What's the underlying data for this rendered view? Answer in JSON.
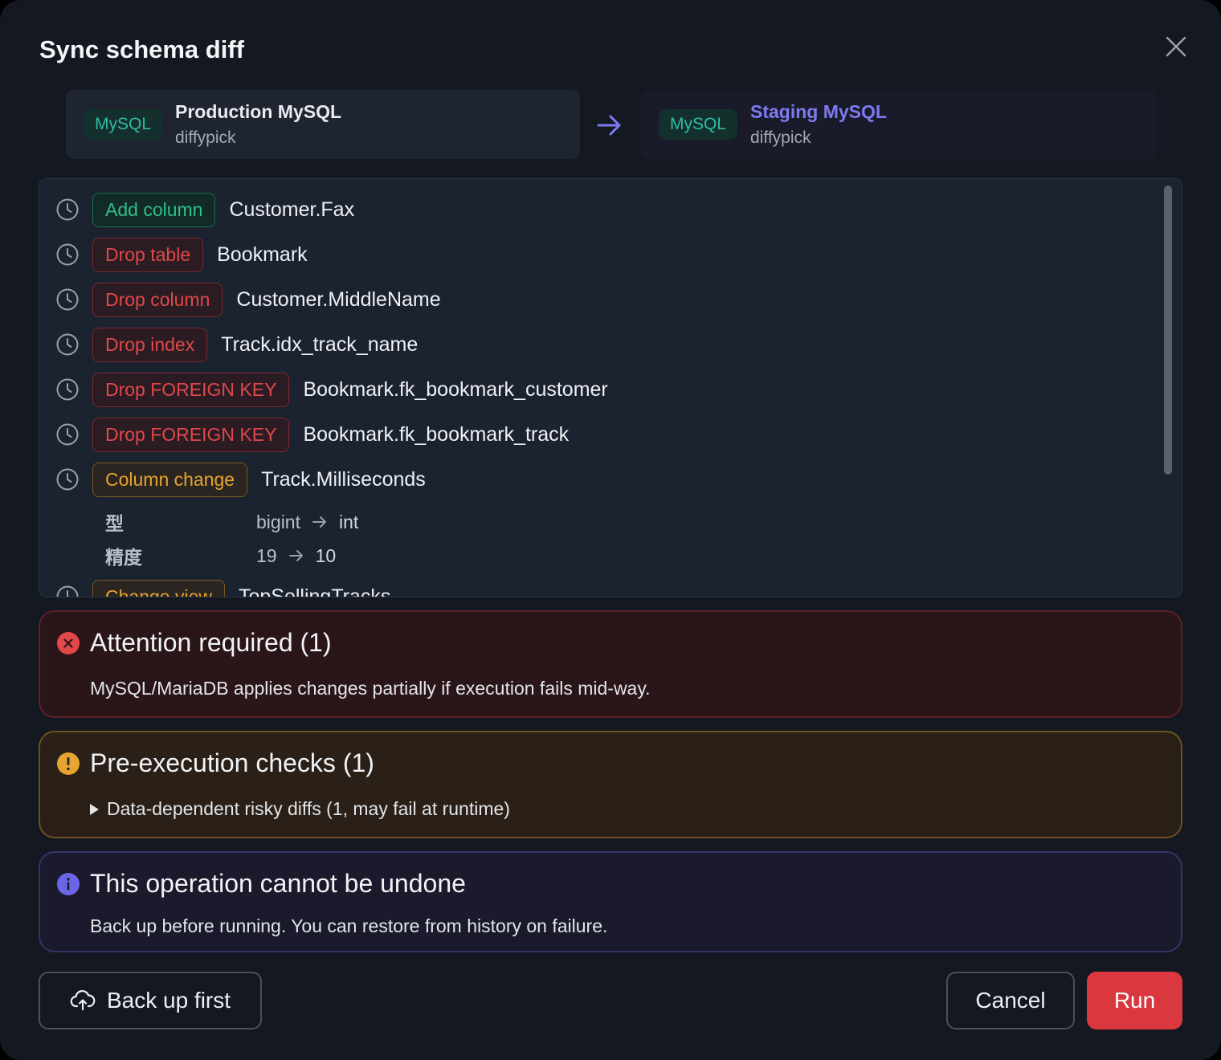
{
  "dialog": {
    "title": "Sync schema diff",
    "close_icon": "close-icon"
  },
  "source": {
    "badge": "MySQL",
    "name": "Production MySQL",
    "database": "diffypick"
  },
  "target": {
    "badge": "MySQL",
    "name": "Staging MySQL",
    "database": "diffypick"
  },
  "diffs": [
    {
      "tag": "Add column",
      "kind": "add",
      "object": "Customer.Fax"
    },
    {
      "tag": "Drop table",
      "kind": "drop",
      "object": "Bookmark"
    },
    {
      "tag": "Drop column",
      "kind": "drop",
      "object": "Customer.MiddleName"
    },
    {
      "tag": "Drop index",
      "kind": "drop",
      "object": "Track.idx_track_name"
    },
    {
      "tag": "Drop FOREIGN KEY",
      "kind": "drop",
      "object": "Bookmark.fk_bookmark_customer"
    },
    {
      "tag": "Drop FOREIGN KEY",
      "kind": "drop",
      "object": "Bookmark.fk_bookmark_track"
    },
    {
      "tag": "Column change",
      "kind": "change",
      "object": "Track.Milliseconds"
    },
    {
      "tag": "Change view",
      "kind": "change",
      "object": "TopSellingTracks"
    }
  ],
  "column_change_details": [
    {
      "key": "型",
      "from": "bigint",
      "to": "int"
    },
    {
      "key": "精度",
      "from": "19",
      "to": "10"
    }
  ],
  "alerts": {
    "attention": {
      "title": "Attention required (1)",
      "body": "MySQL/MariaDB applies changes partially if execution fails mid-way."
    },
    "checks": {
      "title": "Pre-execution checks (1)",
      "body": "Data-dependent risky diffs (1, may fail at runtime)"
    },
    "undo": {
      "title": "This operation cannot be undone",
      "body": "Back up before running. You can restore from history on failure."
    }
  },
  "buttons": {
    "backup": "Back up first",
    "cancel": "Cancel",
    "run": "Run"
  },
  "colors": {
    "accent": "#7f7af0",
    "danger": "#d9393e",
    "add": "#2fbf8a",
    "warn": "#e6a431"
  }
}
